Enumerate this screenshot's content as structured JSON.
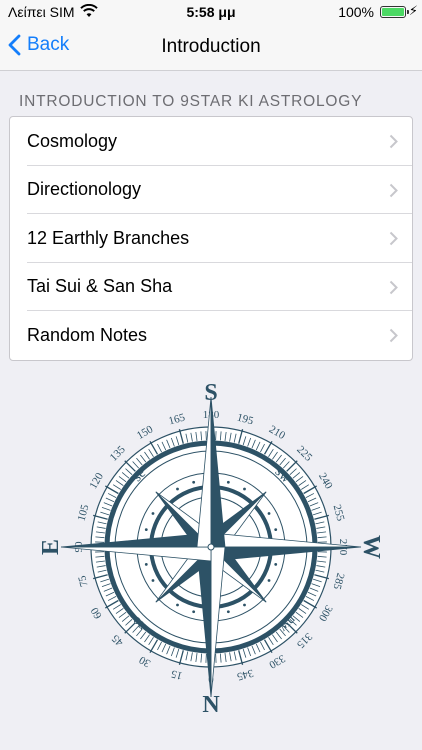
{
  "status_bar": {
    "carrier": "Λείπει SIM",
    "time": "5:58 μμ",
    "battery": "100%",
    "battery_level": 1.0,
    "icons": [
      "wifi-icon",
      "battery-icon",
      "charging-bolt-icon"
    ]
  },
  "nav": {
    "back_label": "Back",
    "title": "Introduction"
  },
  "section": {
    "header": "INTRODUCTION TO 9STAR KI ASTROLOGY",
    "items": [
      {
        "label": "Cosmology"
      },
      {
        "label": "Directionology"
      },
      {
        "label": "12 Earthly Branches"
      },
      {
        "label": "Tai Sui & San Sha"
      },
      {
        "label": "Random Notes"
      }
    ]
  },
  "compass": {
    "cardinals": {
      "top": "S",
      "bottom": "N",
      "left": "E",
      "right": "W"
    },
    "intercardinals": {
      "top_left": "se",
      "top_right": "sw",
      "bottom_left": "ne",
      "bottom_right": "nw"
    },
    "degree_labels": [
      "0",
      "15",
      "30",
      "45",
      "60",
      "75",
      "90",
      "105",
      "120",
      "135",
      "150",
      "165",
      "180",
      "195",
      "210",
      "225",
      "240",
      "255",
      "270",
      "285",
      "300",
      "315",
      "330",
      "345"
    ],
    "colors": {
      "primary": "#2d5266",
      "light": "#dfe7ec"
    }
  },
  "colors": {
    "accent": "#147efb",
    "background": "#efeff4"
  }
}
